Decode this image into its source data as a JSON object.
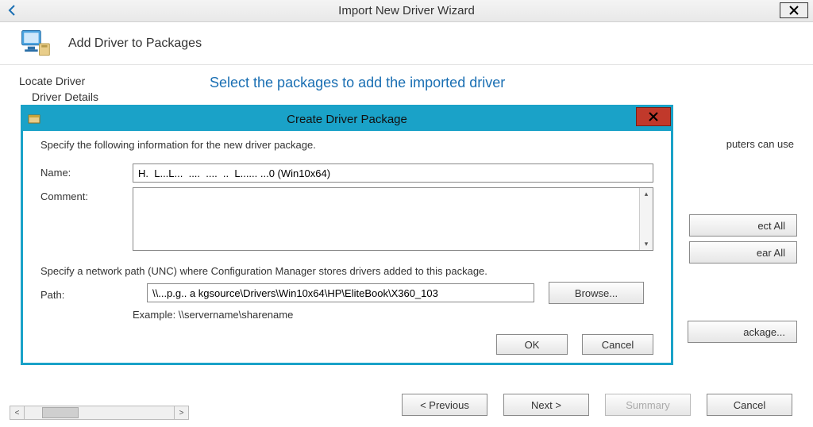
{
  "wizard": {
    "title": "Import New Driver Wizard",
    "header_title": "Add Driver to Packages",
    "sidebar": {
      "items": [
        {
          "label": "Locate Driver",
          "sub": false
        },
        {
          "label": "Driver Details",
          "sub": true
        }
      ]
    },
    "content": {
      "heading": "Select the packages to add the imported driver",
      "subtext_tail": "puters can use"
    },
    "side_buttons": {
      "select_all": "ect All",
      "clear_all": "ear All",
      "new_package": "ackage..."
    },
    "footer": {
      "previous": "< Previous",
      "next": "Next >",
      "summary": "Summary",
      "cancel": "Cancel"
    }
  },
  "modal": {
    "title": "Create Driver Package",
    "instruction": "Specify the following information for the new driver package.",
    "name_label": "Name:",
    "name_value": "H.  L...L...  ....  ....  ..  L...... ...0 (Win10x64)",
    "comment_label": "Comment:",
    "unc_instruction": "Specify a network path (UNC) where Configuration Manager stores drivers added to this package.",
    "path_label": "Path:",
    "path_value": "\\\\...p.g.. a kgsource\\Drivers\\Win10x64\\HP\\EliteBook\\X360_103",
    "browse": "Browse...",
    "example": "Example: \\\\servername\\sharename",
    "ok": "OK",
    "cancel": "Cancel"
  }
}
